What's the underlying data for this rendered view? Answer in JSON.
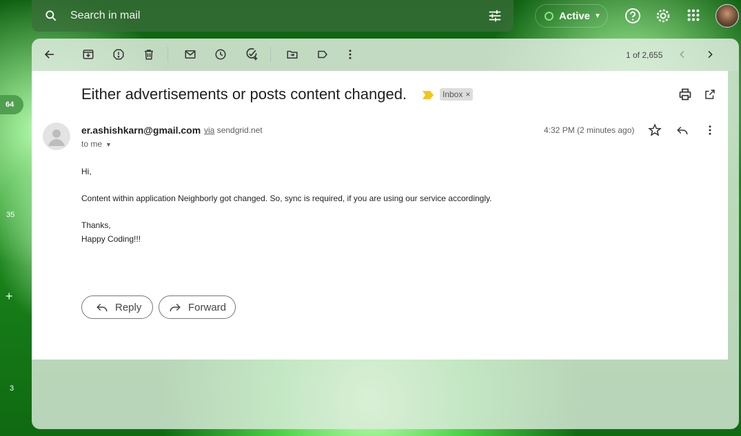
{
  "search": {
    "placeholder": "Search in mail"
  },
  "status": {
    "label": "Active"
  },
  "left_rail": {
    "badge_count": "64",
    "count_b": "35",
    "count_c": "3"
  },
  "toolbar": {
    "pager": "1 of 2,655"
  },
  "message": {
    "subject": "Either advertisements or posts content changed.",
    "label": "Inbox",
    "label_remove": "×",
    "sender": "er.ashishkarn@gmail.com",
    "via_word": "via",
    "via_domain": "sendgrid.net",
    "recipient": "to me",
    "time": "4:32 PM (2 minutes ago)",
    "body": {
      "greeting": "Hi,",
      "line1": "Content within application Neighborly got changed. So, sync is required, if you are using our service accordingly.",
      "signoff": "Thanks,",
      "signature": "Happy Coding!!!"
    }
  },
  "actions": {
    "reply": "Reply",
    "forward": "Forward"
  },
  "colors": {
    "accent": "#0b57d0",
    "importance": "#f5c518",
    "background": "#1c8a1c"
  },
  "icons": [
    "search-icon",
    "tune-icon",
    "help-icon",
    "settings-icon",
    "apps-icon",
    "back-icon",
    "archive-icon",
    "spam-icon",
    "delete-icon",
    "mark-unread-icon",
    "snooze-icon",
    "add-task-icon",
    "move-to-icon",
    "label-icon",
    "more-icon",
    "chevron-left-icon",
    "chevron-right-icon",
    "print-icon",
    "open-in-new-icon",
    "star-icon",
    "reply-icon",
    "forward-icon"
  ]
}
